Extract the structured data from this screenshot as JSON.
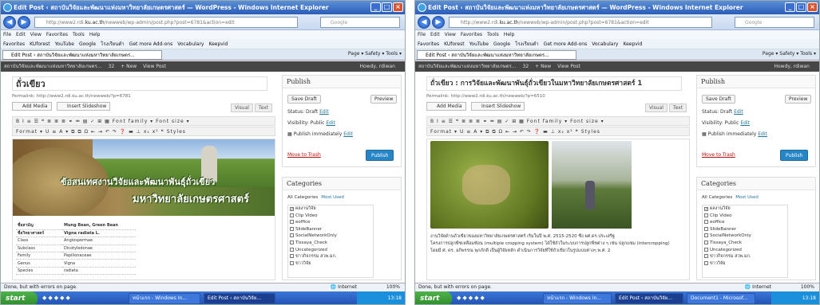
{
  "left": {
    "window_title": "Edit Post ‹ สถาบันวิจัยและพัฒนาแห่งมหาวิทยาลัยเกษตรศาสตร์ — WordPress - Windows Internet Explorer",
    "address_prefix": "http://www2.rdi.",
    "address_domain": "ku.ac.th",
    "address_suffix": "/newweb/wp-admin/post.php?post=6781&action=edit",
    "search_placeholder": "Google",
    "menu": [
      "File",
      "Edit",
      "View",
      "Favorites",
      "Tools",
      "Help"
    ],
    "favorites": [
      "Favorites",
      "KUforest",
      "YouTube",
      "Google",
      "โรงเรียนดำ",
      "Get more Add-ons",
      "Vocabulary",
      "Keepvid"
    ],
    "tab_label": "Edit Post ‹ สถาบันวิจัยและพัฒนาแห่งมหาวิทยาลัยเกษตร...",
    "ie_tools": "Page ▾  Safety ▾  Tools ▾",
    "wp_bar": [
      "สถาบันวิจัยและพัฒนาแห่งมหาวิทยาลัยเกษตร...",
      "32",
      "+ New",
      "View Post"
    ],
    "howdy": "Howdy, rdiwan",
    "post_title": "ถั่วเขียว",
    "permalink": "Permalink: http://www2.rdi.ku.ac.th/newweb/?p=6781",
    "add_media": "Add Media",
    "insert_slideshow": "Insert Slideshow",
    "visual_tab": "Visual",
    "text_tab": "Text",
    "toolbar1": "B  I  ≡  ☰  ❝  ≣  ≣  ≣  ⚭  ⚮  ▤  ✓  ⊞  ▦   Font family ▾   Font size ▾",
    "toolbar2": "Format ▾   U  ≡  A ▾  ⧉  ⧉  Ω  ⇤  ⇥  ↶  ↷  ❓  ▬  ⊥  x₂  x²  ❝  Styles",
    "banner_line1": "ข้อสนเทศงานวิจัยและพัฒนาพันธุ์ถั่วเขียว",
    "banner_line2": "มหาวิทยาลัยเกษตรศาสตร์",
    "table_rows": [
      {
        "k": "ชื่อสามัญ",
        "v": "Mung Bean, Green Bean",
        "bold": true
      },
      {
        "k": "ชื่อวิทยาศาสตร์",
        "v": "Vigna radiata L.",
        "bold": true
      },
      {
        "k": "Class",
        "v": "Angiospermae",
        "bold": false
      },
      {
        "k": "Subclass",
        "v": "Dicotyledonae",
        "bold": false
      },
      {
        "k": "Family",
        "v": "Papilionaceae",
        "bold": false
      },
      {
        "k": "Genus",
        "v": "Vigna",
        "bold": false
      },
      {
        "k": "Species",
        "v": "radiata",
        "bold": false
      }
    ],
    "publish_title": "Publish",
    "save_draft": "Save Draft",
    "preview": "Preview",
    "status_label": "Status: Draft",
    "visibility_label": "Visibility: Public",
    "publish_when": "Publish immediately",
    "edit_link": "Edit",
    "move_to_trash": "Move to Trash",
    "publish_btn": "Publish",
    "categories_title": "Categories",
    "all_categories": "All Categories",
    "most_used": "Most Used",
    "categories": [
      {
        "label": "ผลงานวิจัย",
        "checked": true
      },
      {
        "label": "Clip Video",
        "checked": false
      },
      {
        "label": "eoffice",
        "checked": false
      },
      {
        "label": "SlideBanner",
        "checked": false
      },
      {
        "label": "SocialNetworkOnly",
        "checked": false
      },
      {
        "label": "Tissaya_Check",
        "checked": false
      },
      {
        "label": "Uncategorized",
        "checked": false
      },
      {
        "label": "ข่าวกิจกรรม สวพ.มก.",
        "checked": false
      },
      {
        "label": "ข่าววิจัย",
        "checked": false
      }
    ],
    "status_text": "Done, but with errors on page.",
    "zone": "Internet",
    "zoom": "100%",
    "start": "start",
    "taskbar_items": [
      "หน้าแรก - Windows In...",
      "Edit Post ‹ สถาบันวิจัย..."
    ],
    "clock": "13:18"
  },
  "right": {
    "window_title": "Edit Post ‹ สถาบันวิจัยและพัฒนาแห่งมหาวิทยาลัยเกษตรศาสตร์ — WordPress - Windows Internet Explorer",
    "address_prefix": "http://www2.rdi.",
    "address_domain": "ku.ac.th",
    "address_suffix": "/newweb/wp-admin/post.php?post=6781&action=edit",
    "search_placeholder": "Google",
    "menu": [
      "File",
      "Edit",
      "View",
      "Favorites",
      "Tools",
      "Help"
    ],
    "favorites": [
      "Favorites",
      "KUforest",
      "YouTube",
      "Google",
      "โรงเรียนดำ",
      "Get more Add-ons",
      "Vocabulary",
      "Keepvid"
    ],
    "tab_label": "Edit Post ‹ สถาบันวิจัยและพัฒนาแห่งมหาวิทยาลัยเกษตร...",
    "ie_tools": "Page ▾  Safety ▾  Tools ▾",
    "wp_bar": [
      "สถาบันวิจัยและพัฒนาแห่งมหาวิทยาลัยเกษตร...",
      "32",
      "+ New",
      "View Post"
    ],
    "howdy": "Howdy, rdiwan",
    "post_title": "ถั่วเขียว : การวิจัยและพัฒนาพันธุ์ถั่วเขียวในมหาวิทยาลัยเกษตรศาสตร์ 1",
    "permalink": "Permalink: http://www2.rdi.ku.ac.th/newweb/?p=6510",
    "add_media": "Add Media",
    "insert_slideshow": "Insert Slideshow",
    "visual_tab": "Visual",
    "text_tab": "Text",
    "toolbar1": "B  I  ≡  ☰  ❝  ≣  ≣  ≣  ⚭  ⚮  ▤  ✓  ⊞  ▦   Font family ▾   Font size ▾",
    "toolbar2": "Format ▾   U  ≡  A ▾  ⧉  ⧉  Ω  ⇤  ⇥  ↶  ↷  ❓  ▬  ⊥  x₂  x²  ❝  Styles",
    "body_lines": [
      "งานวิจัยด้านถั่วเขียวของมหาวิทยาลัยเกษตรศาสตร์ เริ่มในปี พ.ศ. 2515-2520 ซึ่ง ผศ.ดร.ประเสริฐ",
      "โครงการปลูกพืชเหลื่อมซ้อน (multiple cropping system) ได้ใช้ถั่วในระบบการปลูกพืชต่าง ๆ เช่น ปลูกแซม (intercropping)",
      "โดยมี ศ. ดร. อภิพรรณ พุกภักดี เป็นผู้วิจัยหลัก ดำเนินการวิจัยที่ใช้ถั่วเขียวในรูปแบบต่างๆ พ.ศ. 2"
    ],
    "publish_title": "Publish",
    "save_draft": "Save Draft",
    "preview": "Preview",
    "status_label": "Status: Draft",
    "visibility_label": "Visibility: Public",
    "publish_when": "Publish immediately",
    "edit_link": "Edit",
    "move_to_trash": "Move to Trash",
    "publish_btn": "Publish",
    "categories_title": "Categories",
    "all_categories": "All Categories",
    "most_used": "Most Used",
    "categories": [
      {
        "label": "ผลงานวิจัย",
        "checked": true
      },
      {
        "label": "Clip Video",
        "checked": false
      },
      {
        "label": "eoffice",
        "checked": false
      },
      {
        "label": "SlideBanner",
        "checked": false
      },
      {
        "label": "SocialNetworkOnly",
        "checked": false
      },
      {
        "label": "Tissaya_Check",
        "checked": false
      },
      {
        "label": "Uncategorized",
        "checked": false
      },
      {
        "label": "ข่าวกิจกรรม สวพ.มก.",
        "checked": false
      },
      {
        "label": "ข่าววิจัย",
        "checked": false
      }
    ],
    "status_text": "Done, but with errors on page.",
    "zone": "Internet",
    "zoom": "100%",
    "start": "start",
    "taskbar_items": [
      "หน้าแรก - Windows In...",
      "Edit Post ‹ สถาบันวิจัย...",
      "Document1 - Microsof..."
    ],
    "clock": "13:18"
  },
  "colors": {
    "accent": "#2585c5",
    "trash": "#bc0b0b",
    "link": "#21759b",
    "taskbar": "#1f4fb0"
  }
}
